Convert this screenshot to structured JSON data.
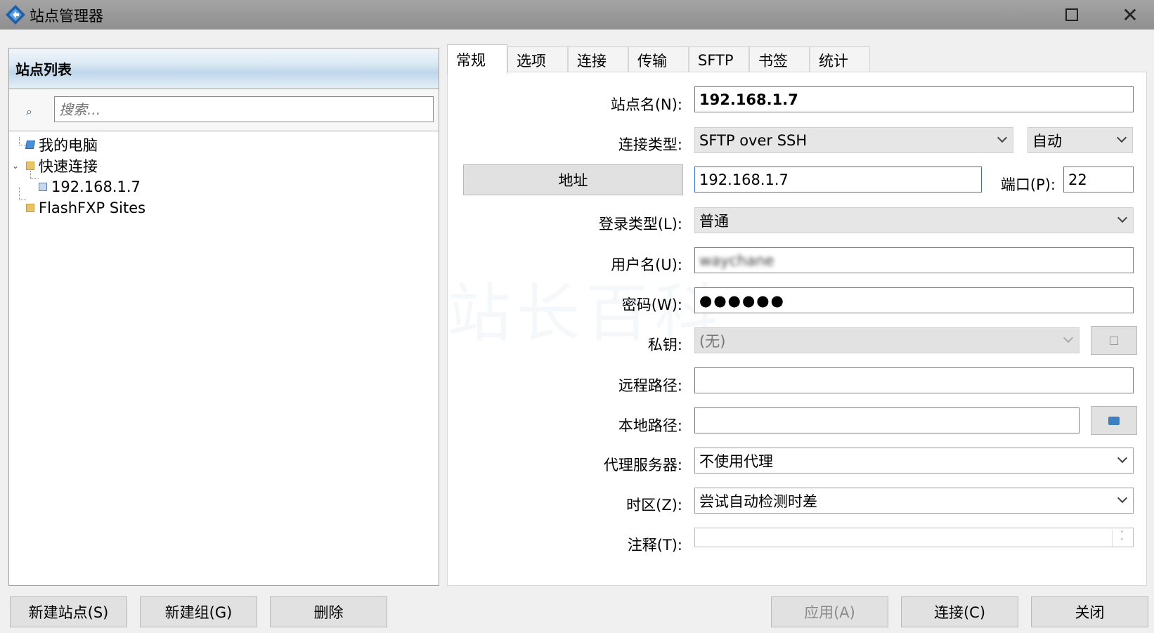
{
  "window": {
    "title": "站点管理器"
  },
  "site_list": {
    "header": "站点列表",
    "search_placeholder": "搜索...",
    "tree": [
      {
        "label": "我的电脑",
        "icon": "computer-icon"
      },
      {
        "label": "快速连接",
        "icon": "folder-icon",
        "expanded": true
      },
      {
        "label": "192.168.1.7",
        "icon": "site-icon"
      },
      {
        "label": "FlashFXP Sites",
        "icon": "folder-icon"
      }
    ]
  },
  "tabs": [
    "常规",
    "选项",
    "连接",
    "传输",
    "SFTP",
    "书签",
    "统计"
  ],
  "form": {
    "site_name_label": "站点名(N):",
    "site_name": "192.168.1.7",
    "conn_type_label": "连接类型:",
    "conn_type": "SFTP over SSH",
    "conn_mode": "自动",
    "address_button": "地址",
    "address": "192.168.1.7",
    "port_label": "端口(P):",
    "port": "22",
    "login_type_label": "登录类型(L):",
    "login_type": "普通",
    "username_label": "用户名(U):",
    "username": "waychane",
    "password_label": "密码(W):",
    "password": "●●●●●●",
    "private_key_label": "私钥:",
    "private_key": "(无)",
    "remote_path_label": "远程路径:",
    "remote_path": "",
    "local_path_label": "本地路径:",
    "local_path": "",
    "proxy_label": "代理服务器:",
    "proxy": "不使用代理",
    "timezone_label": "时区(Z):",
    "timezone": "尝试自动检测时差",
    "comment_label": "注释(T):",
    "comment": ""
  },
  "buttons": {
    "new_site": "新建站点(S)",
    "new_group": "新建组(G)",
    "delete": "删除",
    "apply": "应用(A)",
    "connect": "连接(C)",
    "close": "关闭"
  },
  "watermark": "站长百科",
  "colors": {
    "focus_border": "#2f74c0",
    "title_bar": "#9a9a9a"
  }
}
